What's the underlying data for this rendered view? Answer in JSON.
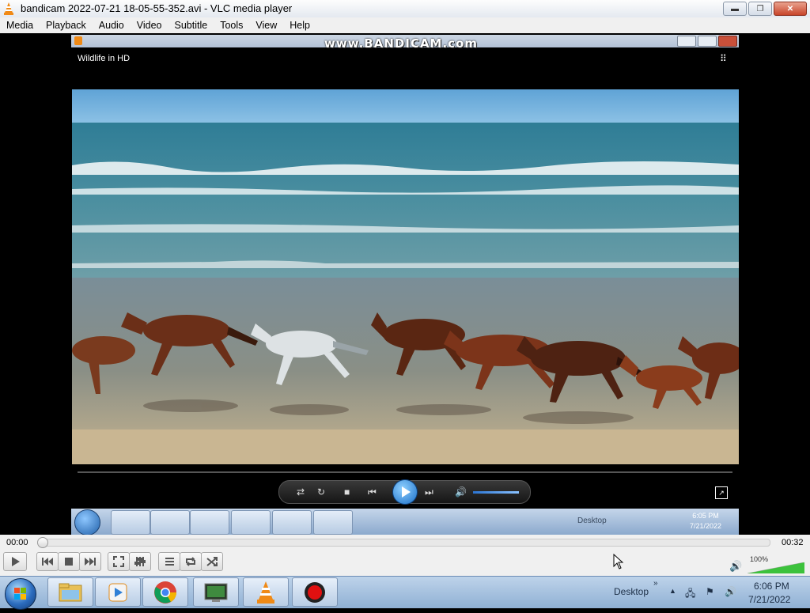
{
  "window": {
    "title": "bandicam 2022-07-21 18-05-55-352.avi - VLC media player",
    "buttons": {
      "minimize": "▬",
      "maximize": "❐",
      "close": "✕"
    }
  },
  "menubar": {
    "items": [
      "Media",
      "Playback",
      "Audio",
      "Video",
      "Subtitle",
      "Tools",
      "View",
      "Help"
    ]
  },
  "video": {
    "watermark": "www.BANDICAM.com",
    "overlay_title": "Wildlife in HD",
    "inner_taskbar": {
      "desktop_label": "Desktop",
      "clock_time": "6:05 PM",
      "clock_date": "7/21/2022"
    }
  },
  "controls": {
    "time_elapsed": "00:00",
    "time_total": "00:32",
    "seek_progress": 0,
    "volume_percent_label": "100%",
    "volume_level": 1.0,
    "icons": [
      "play-icon",
      "previous-icon",
      "stop-icon",
      "next-icon",
      "fullscreen-icon",
      "extended-settings-icon",
      "playlist-icon",
      "loop-icon",
      "shuffle-icon"
    ]
  },
  "taskbar": {
    "desktop_label": "Desktop",
    "clock_time": "6:06 PM",
    "clock_date": "7/21/2022",
    "pinned": [
      "file-explorer-icon",
      "media-player-icon",
      "chrome-icon",
      "terminal-icon",
      "vlc-icon",
      "bandicam-icon"
    ]
  },
  "colors": {
    "vlc_orange": "#f08a16",
    "accent_blue": "#2b74d2",
    "record_red": "#e01010",
    "volume_green": "#3cc23c"
  }
}
